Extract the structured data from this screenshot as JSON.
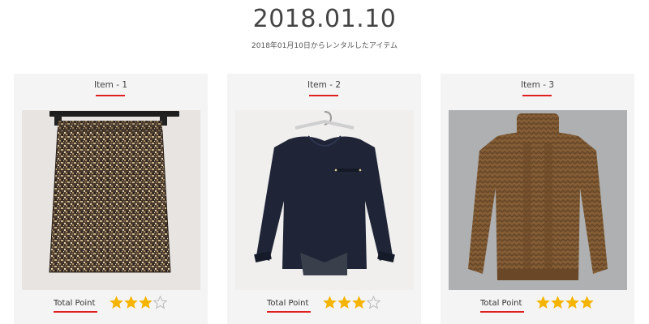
{
  "header": {
    "date": "2018.01.10",
    "subtitle": "2018年01月10日からレンタルしたアイテム"
  },
  "colors": {
    "accent_underline": "#e0201e",
    "star_filled": "#f5b400",
    "star_empty": "#b9b9b9",
    "card_background": "#f4f4f4"
  },
  "items": [
    {
      "title": "Item - 1",
      "image": "tweed-pencil-skirt",
      "total_label": "Total Point",
      "rating": 3,
      "rating_max": 4
    },
    {
      "title": "Item - 2",
      "image": "navy-blouse-on-hanger",
      "total_label": "Total Point",
      "rating": 3,
      "rating_max": 4
    },
    {
      "title": "Item - 3",
      "image": "brown-turtleneck-sweater",
      "total_label": "Total Point",
      "rating": 4,
      "rating_max": 4
    }
  ]
}
